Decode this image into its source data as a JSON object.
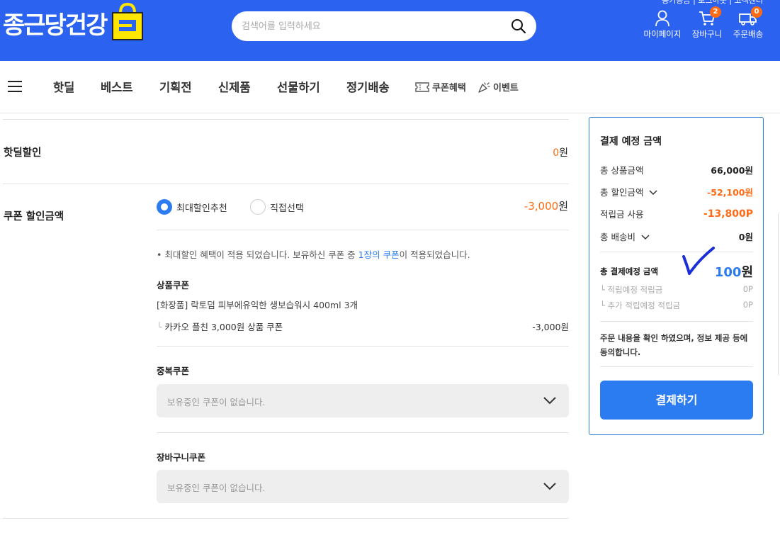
{
  "header": {
    "logo_text": "종근당건강",
    "search_placeholder": "검색어를 입력하세요",
    "top_links": "종기승금 | 로그아웃 | 고객센터",
    "icons": [
      {
        "label": "마이페이지",
        "icon": "user-icon"
      },
      {
        "label": "장바구니",
        "icon": "cart-icon",
        "badge": "2"
      },
      {
        "label": "주문배송",
        "icon": "truck-icon",
        "badge": "0"
      }
    ],
    "brand_color": "#2b63f0"
  },
  "nav": {
    "items": [
      "핫딜",
      "베스트",
      "기획전",
      "신제품",
      "선물하기",
      "정기배송"
    ],
    "coupon": "쿠폰혜택",
    "event": "이벤트"
  },
  "main": {
    "hotdeal": {
      "label": "핫딜할인",
      "amount_num": "0",
      "amount_unit": "원"
    },
    "coupon": {
      "label": "쿠폰 할인금액",
      "amount_num": "-3,000",
      "amount_unit": "원",
      "radio_recommend": "최대할인추천",
      "radio_manual": "직접선택",
      "note_pre": "최대할인 혜택이 적용 되었습니다. 보유하신 쿠폰 중 ",
      "note_link": "1장의 쿠폰",
      "note_post": "이 적용되었습니다.",
      "product_coupon": {
        "title": "상품쿠폰",
        "product": "[화장품] 락토덤 피부에유익한 생보습워시 400ml 3개",
        "coupon_name": "카카오 플친 3,000원 상품 쿠폰",
        "coupon_amount": "-3,000원"
      },
      "duplicate_coupon": {
        "title": "중복쿠폰",
        "placeholder": "보유중인 쿠폰이 없습니다."
      },
      "cart_coupon": {
        "title": "장바구니쿠폰",
        "placeholder": "보유중인 쿠폰이 없습니다."
      }
    }
  },
  "summary": {
    "title": "결제 예정 금액",
    "rows": [
      {
        "label": "총 상품금액",
        "value": "66,000원"
      },
      {
        "label": "총 할인금액",
        "value": "-52,100원"
      },
      {
        "label": "적립금 사용",
        "value": "-13,800P"
      },
      {
        "label": "총 배송비",
        "value": "0원"
      }
    ],
    "total_label": "총 결제예정 금액",
    "total_num": "100",
    "total_unit": "원",
    "points": [
      {
        "label": "└ 적립예정 적립금",
        "value": "0P"
      },
      {
        "label": "└ 추가 적립예정 적립금",
        "value": "0P"
      }
    ],
    "agree_text": "주문 내용을 확인 하였으며, 정보 제공 등에 동의합니다.",
    "pay_button": "결제하기",
    "accent_color": "#2b7cf0",
    "discount_color": "#ff6a13"
  }
}
